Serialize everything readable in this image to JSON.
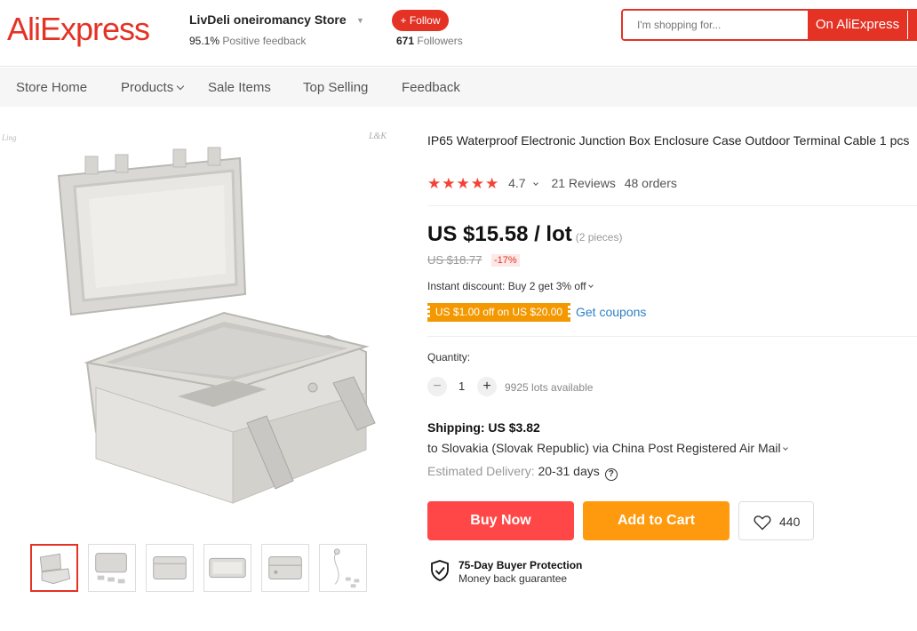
{
  "header": {
    "logo": "AliExpress",
    "store_name": "LivDeli oneiromancy Store",
    "feedback_pct": "95.1%",
    "feedback_label": "Positive feedback",
    "follow_label": "+ Follow",
    "followers_count": "671",
    "followers_label": "Followers",
    "search_placeholder": "I'm shopping for...",
    "search_button": "On AliExpress"
  },
  "nav": {
    "items": [
      "Store Home",
      "Products",
      "Sale Items",
      "Top Selling",
      "Feedback"
    ]
  },
  "gallery": {
    "watermark_left": "Ling",
    "watermark_right": "L&K",
    "thumbnail_count": 6,
    "active_index": 0
  },
  "product": {
    "title": "IP65 Waterproof Electronic Junction Box Enclosure Case Outdoor Terminal Cable 1 pcs",
    "rating": "4.7",
    "reviews": "21 Reviews",
    "orders": "48 orders",
    "price": "US $15.58 / lot",
    "pieces": "(2 pieces)",
    "old_price": "US $18.77",
    "discount": "-17%",
    "instant_discount": "Instant discount: Buy 2 get 3% off",
    "coupon": "US $1.00 off on US $20.00",
    "get_coupons": "Get coupons",
    "quantity_label": "Quantity:",
    "quantity_value": "1",
    "available": "9925 lots available",
    "shipping_label": "Shipping: US $3.82",
    "shipping_dest": "to Slovakia (Slovak Republic) via China Post Registered Air Mail",
    "delivery_label": "Estimated Delivery:",
    "delivery_value": "20-31 days",
    "buy_now": "Buy Now",
    "add_to_cart": "Add to Cart",
    "wishlist_count": "440",
    "protection_title": "75-Day Buyer Protection",
    "protection_sub": "Money back guarantee"
  },
  "colors": {
    "brand": "#e43225",
    "buy": "#ff4747",
    "cart": "#ff9a0e",
    "coupon": "#f39800",
    "star": "#f44336",
    "link": "#2e7fc7"
  }
}
